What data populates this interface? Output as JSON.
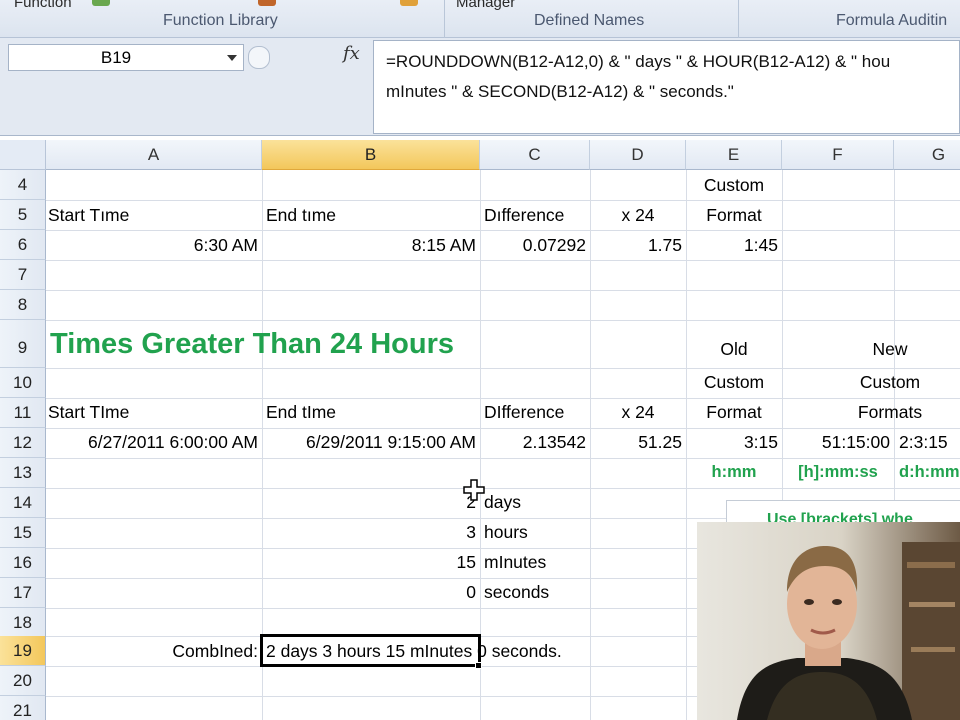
{
  "ribbon": {
    "top_left": "Function",
    "top_mid": "Manager",
    "groups": [
      "Function Library",
      "Defined Names",
      "Formula Auditin"
    ]
  },
  "formula_bar": {
    "name_box": "B19",
    "fx_icon": "fx-icon",
    "formula": "=ROUNDDOWN(B12-A12,0) & \" days \" & HOUR(B12-A12) & \" hou\nmInutes \" & SECOND(B12-A12) & \" seconds.\""
  },
  "columns": [
    "A",
    "B",
    "C",
    "D",
    "E",
    "F",
    "G"
  ],
  "rows": [
    "4",
    "5",
    "6",
    "7",
    "8",
    "9",
    "10",
    "11",
    "12",
    "13",
    "14",
    "15",
    "16",
    "17",
    "18",
    "19",
    "20",
    "21"
  ],
  "cells": {
    "E4": "Custom",
    "A5": "Start Tıme",
    "B5": "End tıme",
    "C5": "Dıfference",
    "D5": "x 24",
    "E5": "Format",
    "A6": "6:30 AM",
    "B6": "8:15 AM",
    "C6": "0.07292",
    "D6": "1.75",
    "E6": "1:45",
    "A9": "Times Greater Than 24 Hours",
    "E9": "Old",
    "F9": "New",
    "E10": "Custom",
    "F10": "Custom",
    "A11": "Start TIme",
    "B11": "End tIme",
    "C11": "DIfference",
    "D11": "x 24",
    "E11": "Format",
    "F11": "Formats",
    "A12": "6/27/2011 6:00:00 AM",
    "B12": "6/29/2011 9:15:00 AM",
    "C12": "2.13542",
    "D12": "51.25",
    "E12": "3:15",
    "F12": "51:15:00",
    "G12": "2:3:15",
    "E13": "h:mm",
    "F13": "[h]:mm:ss",
    "G13": "d:h:mm",
    "B14": "2",
    "C14": "days",
    "B15": "3",
    "C15": "hours",
    "B16": "15",
    "C16": "mInutes",
    "B17": "0",
    "C17": "seconds",
    "A19": "CombIned:",
    "B19": "2 days 3 hours 15 mInutes 0 seconds."
  },
  "note_box": "Use [brackets] whe",
  "colors": {
    "heading_green": "#21a24e",
    "selected_header": "#f3c75b"
  }
}
